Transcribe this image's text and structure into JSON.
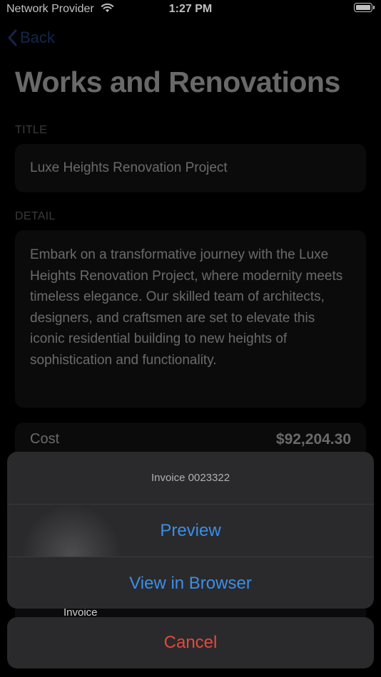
{
  "status_bar": {
    "carrier": "Network Provider",
    "time": "1:27 PM"
  },
  "nav": {
    "back_label": "Back"
  },
  "page": {
    "title": "Works and Renovations",
    "title_label": "TITLE",
    "title_value": "Luxe Heights Renovation Project",
    "detail_label": "DETAIL",
    "detail_value": "Embark on a transformative journey with the Luxe Heights Renovation Project, where modernity meets timeless elegance. Our skilled team of architects, designers, and craftsmen are set to elevate this iconic residential building to new heights of sophistication and functionality.",
    "cost_label": "Cost",
    "cost_value": "$92,204.30",
    "invoice_label": "Invoice"
  },
  "action_sheet": {
    "title": "Invoice 0023322",
    "preview_label": "Preview",
    "browser_label": "View in Browser",
    "cancel_label": "Cancel"
  },
  "colors": {
    "accent": "#3a8fe9",
    "destructive": "#e5483d",
    "back": "#2f5fb3"
  }
}
